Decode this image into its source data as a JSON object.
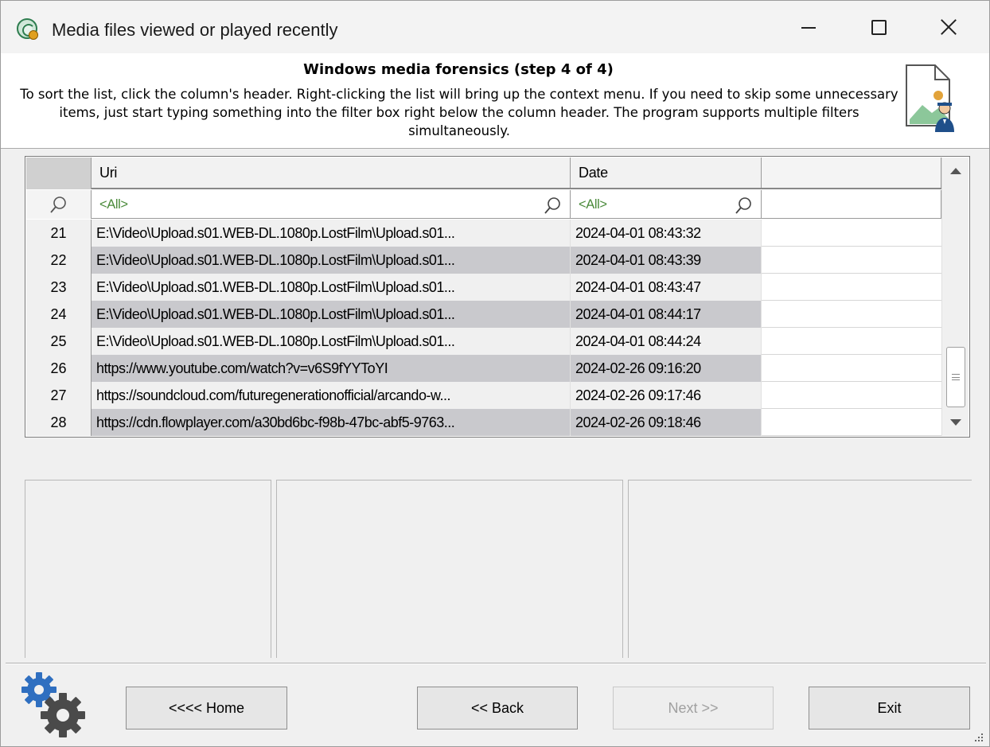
{
  "window": {
    "title": "Media files viewed or played recently"
  },
  "header": {
    "step_title": "Windows media forensics (step 4 of 4)",
    "description": "To sort the list, click the column's header. Right-clicking the list will bring up the context menu. If you need to skip some unnecessary items, just start typing something into the filter box right below the column header. The program supports multiple filters simultaneously."
  },
  "grid": {
    "columns": [
      "Uri",
      "Date"
    ],
    "filters": [
      "<All>",
      "<All>"
    ],
    "rows": [
      {
        "num": "21",
        "uri": "E:\\Video\\Upload.s01.WEB-DL.1080p.LostFilm\\Upload.s01...",
        "date": "2024-04-01 08:43:32"
      },
      {
        "num": "22",
        "uri": "E:\\Video\\Upload.s01.WEB-DL.1080p.LostFilm\\Upload.s01...",
        "date": "2024-04-01 08:43:39"
      },
      {
        "num": "23",
        "uri": "E:\\Video\\Upload.s01.WEB-DL.1080p.LostFilm\\Upload.s01...",
        "date": "2024-04-01 08:43:47"
      },
      {
        "num": "24",
        "uri": "E:\\Video\\Upload.s01.WEB-DL.1080p.LostFilm\\Upload.s01...",
        "date": "2024-04-01 08:44:17"
      },
      {
        "num": "25",
        "uri": "E:\\Video\\Upload.s01.WEB-DL.1080p.LostFilm\\Upload.s01...",
        "date": "2024-04-01 08:44:24"
      },
      {
        "num": "26",
        "uri": "https://www.youtube.com/watch?v=v6S9fYYToYI",
        "date": "2024-02-26 09:16:20"
      },
      {
        "num": "27",
        "uri": "https://soundcloud.com/futuregenerationofficial/arcando-w...",
        "date": "2024-02-26 09:17:46"
      },
      {
        "num": "28",
        "uri": "https://cdn.flowplayer.com/a30bd6bc-f98b-47bc-abf5-9763...",
        "date": "2024-02-26 09:18:46"
      }
    ]
  },
  "buttons": {
    "home": "<<<< Home",
    "back": "<< Back",
    "next": "Next >>",
    "exit": "Exit"
  },
  "icons": {
    "app": "app-icon",
    "header": "document-investigator-icon",
    "settings": "gears-icon",
    "filter": "search-icon"
  }
}
